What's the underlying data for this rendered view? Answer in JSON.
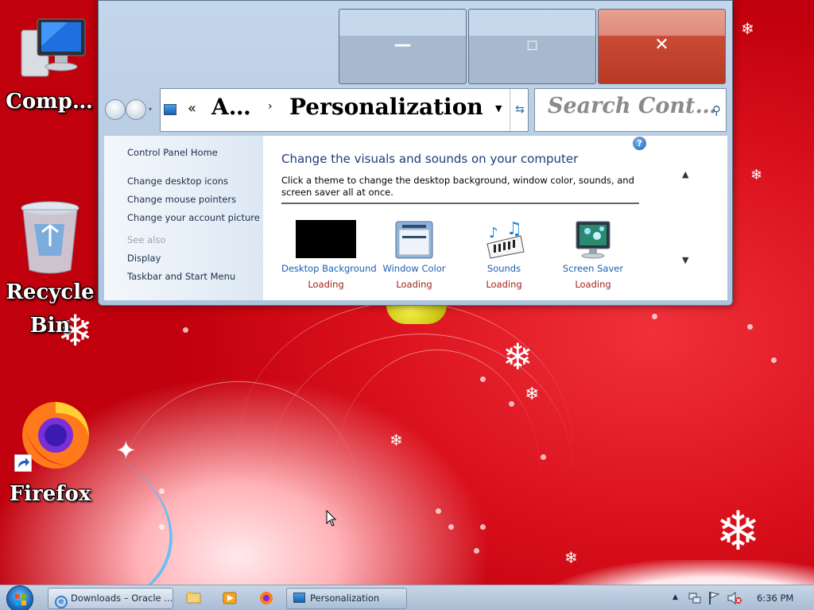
{
  "desktop": {
    "icons": [
      {
        "label": "Comp…"
      },
      {
        "label": "Recycle",
        "label2": "Bin"
      },
      {
        "label": "Firefox"
      }
    ]
  },
  "window": {
    "caption_buttons": {
      "minimize": "—",
      "maximize": "☐",
      "close": "✕"
    },
    "address": {
      "chevron": "«",
      "crumb1": "A…",
      "separator": "›",
      "crumb2": "Personalization"
    },
    "search": {
      "placeholder": "Search Cont…"
    },
    "left_pane": {
      "home": "Control Panel Home",
      "links": [
        "Change desktop icons",
        "Change mouse pointers",
        "Change your account picture"
      ],
      "see_also": "See also",
      "see_also_links": [
        "Display",
        "Taskbar and Start Menu"
      ]
    },
    "main_pane": {
      "title": "Change the visuals and sounds on your computer",
      "description": "Click a theme to change the desktop background, window color, sounds, and screen saver all at once.",
      "items": [
        {
          "name": "Desktop Background",
          "status": "Loading"
        },
        {
          "name": "Window Color",
          "status": "Loading"
        },
        {
          "name": "Sounds",
          "status": "Loading"
        },
        {
          "name": "Screen Saver",
          "status": "Loading"
        }
      ]
    }
  },
  "taskbar": {
    "tasks": [
      {
        "label": "Downloads – Oracle ..."
      },
      {
        "label": "Personalization"
      }
    ],
    "clock": "6:36 PM"
  },
  "colors": {
    "accent_blue": "#1b5fb0",
    "loading_red": "#a3241c",
    "desktop_red": "#d0101a"
  }
}
